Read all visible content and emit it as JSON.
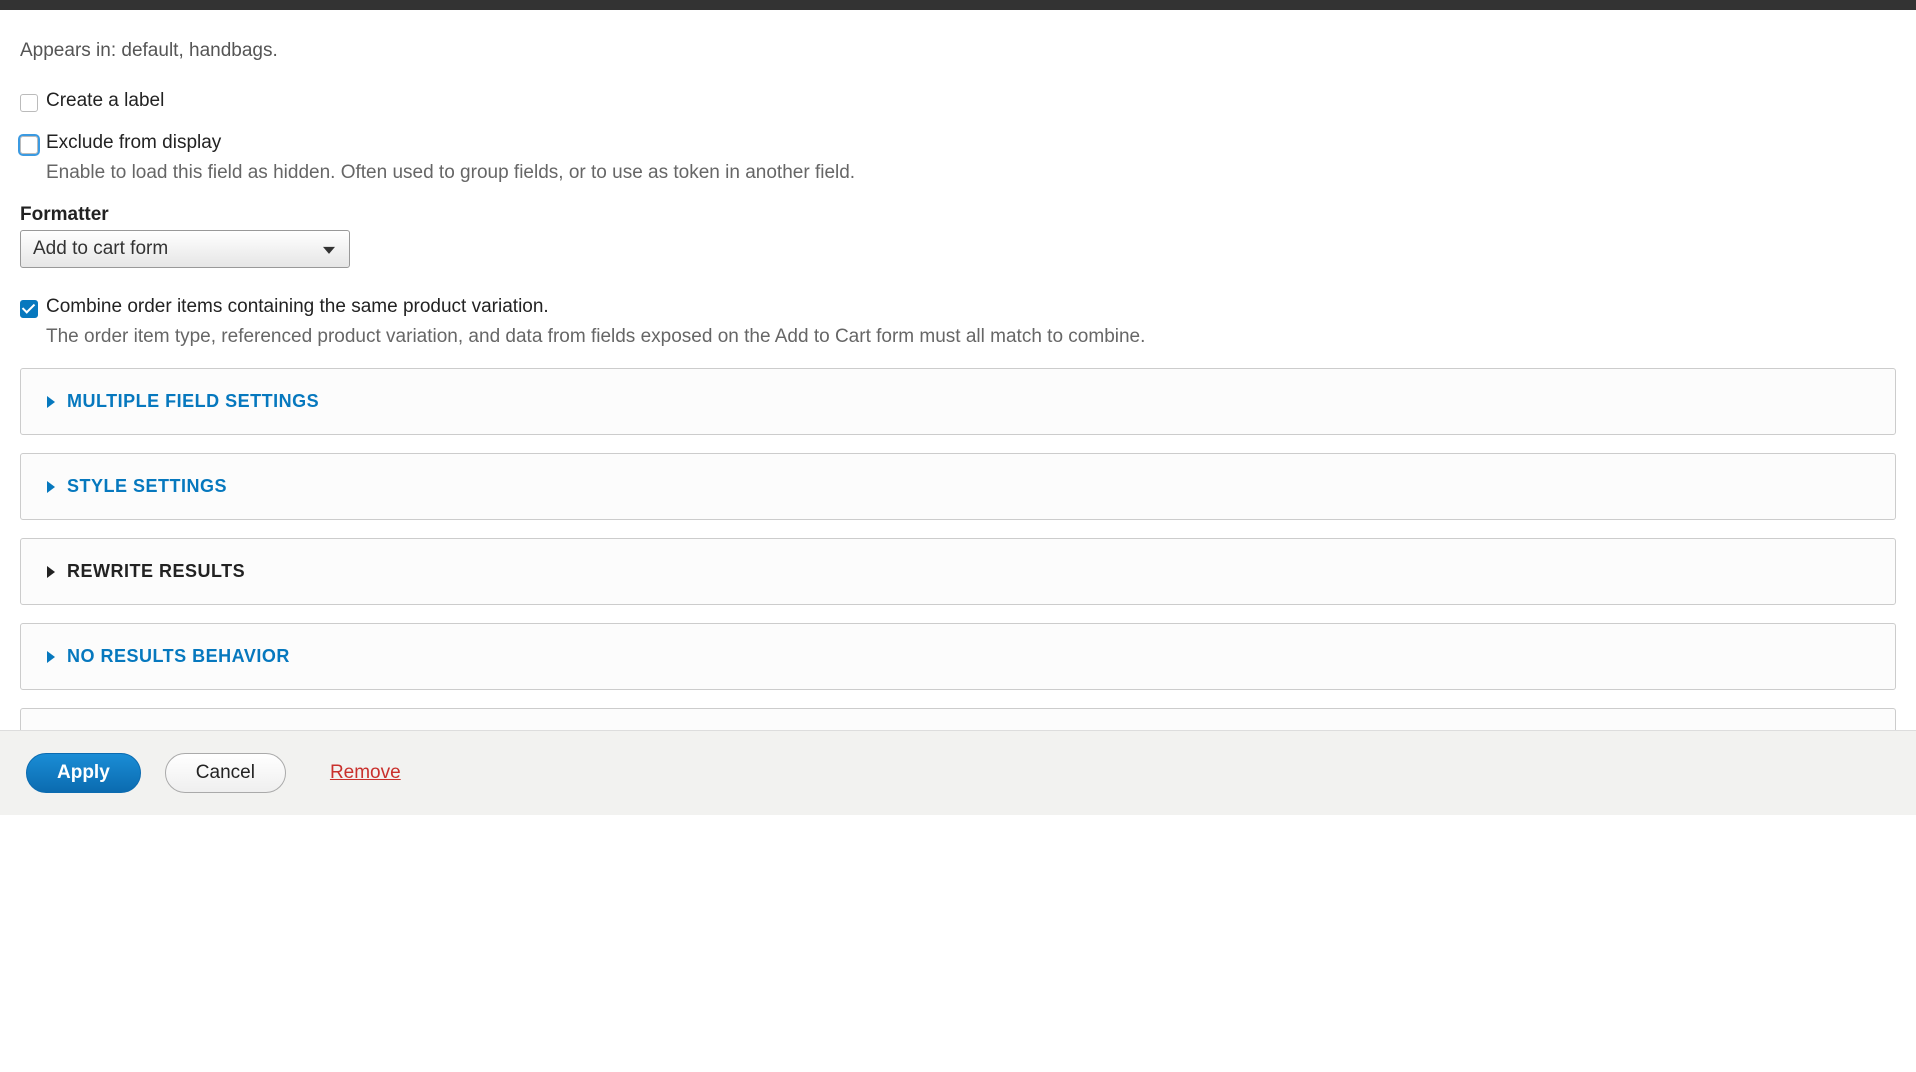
{
  "appears_in": "Appears in: default, handbags.",
  "checkboxes": {
    "create_label": {
      "label": "Create a label",
      "checked": false
    },
    "exclude": {
      "label": "Exclude from display",
      "desc": "Enable to load this field as hidden. Often used to group fields, or to use as token in another field.",
      "checked": false
    },
    "combine": {
      "label": "Combine order items containing the same product variation.",
      "desc": "The order item type, referenced product variation, and data from fields exposed on the Add to Cart form must all match to combine.",
      "checked": true
    }
  },
  "formatter": {
    "label": "Formatter",
    "selected": "Add to cart form"
  },
  "accordions": {
    "multiple_field": "MULTIPLE FIELD SETTINGS",
    "style": "STYLE SETTINGS",
    "rewrite": "REWRITE RESULTS",
    "no_results": "NO RESULTS BEHAVIOR"
  },
  "footer": {
    "apply": "Apply",
    "cancel": "Cancel",
    "remove": "Remove"
  }
}
